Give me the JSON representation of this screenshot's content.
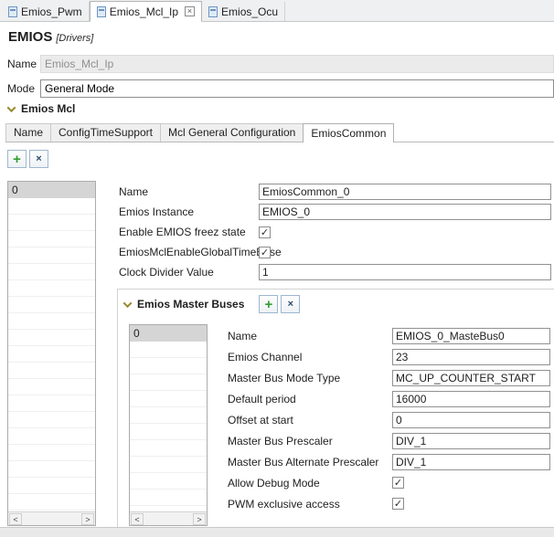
{
  "icons": {
    "check": "✓",
    "close": "×",
    "scroll_left": "<",
    "scroll_right": ">"
  },
  "colors": {
    "accent_add": "#2f9e2f",
    "accent_remove": "#2c4a6e",
    "chevron": "#9a8b2e"
  },
  "editor_tabs": {
    "tabs": [
      {
        "label": "Emios_Pwm",
        "active": false
      },
      {
        "label": "Emios_Mcl_Ip",
        "active": true
      },
      {
        "label": "Emios_Ocu",
        "active": false
      }
    ]
  },
  "header": {
    "title": "EMIOS",
    "subtitle": "[Drivers]"
  },
  "general": {
    "name_label": "Name",
    "name_value": "Emios_Mcl_Ip",
    "mode_label": "Mode",
    "mode_value": "General Mode"
  },
  "mcl": {
    "section_title": "Emios Mcl",
    "tabs": [
      {
        "label": "Name",
        "active": false
      },
      {
        "label": "ConfigTimeSupport",
        "active": false
      },
      {
        "label": "Mcl General Configuration",
        "active": false
      },
      {
        "label": "EmiosCommon",
        "active": true
      }
    ],
    "toolbar": {
      "add_label": "+",
      "remove_label": "×"
    },
    "list": {
      "items": [
        {
          "label": "0",
          "selected": true
        }
      ]
    },
    "fields": [
      {
        "label": "Name",
        "type": "text",
        "value": "EmiosCommon_0"
      },
      {
        "label": "Emios Instance",
        "type": "text",
        "value": "EMIOS_0"
      },
      {
        "label": "Enable EMIOS freez state",
        "type": "checkbox",
        "checked": true
      },
      {
        "label": "EmiosMclEnableGlobalTimeBase",
        "type": "checkbox",
        "checked": true
      },
      {
        "label": "Clock Divider Value",
        "type": "text",
        "value": "1"
      }
    ],
    "master_buses": {
      "section_title": "Emios Master Buses",
      "toolbar": {
        "add_label": "+",
        "remove_label": "×"
      },
      "list": {
        "items": [
          {
            "label": "0",
            "selected": true
          }
        ]
      },
      "fields": [
        {
          "label": "Name",
          "type": "text",
          "value": "EMIOS_0_MasteBus0"
        },
        {
          "label": "Emios Channel",
          "type": "text",
          "value": "23"
        },
        {
          "label": "Master Bus Mode Type",
          "type": "text",
          "value": "MC_UP_COUNTER_START"
        },
        {
          "label": "Default period",
          "type": "text",
          "value": "16000"
        },
        {
          "label": "Offset at start",
          "type": "text",
          "value": "0"
        },
        {
          "label": "Master Bus Prescaler",
          "type": "text",
          "value": "DIV_1"
        },
        {
          "label": "Master Bus Alternate Prescaler",
          "type": "text",
          "value": "DIV_1"
        },
        {
          "label": "Allow Debug Mode",
          "type": "checkbox",
          "checked": true
        },
        {
          "label": "PWM exclusive access",
          "type": "checkbox",
          "checked": true
        }
      ]
    }
  }
}
